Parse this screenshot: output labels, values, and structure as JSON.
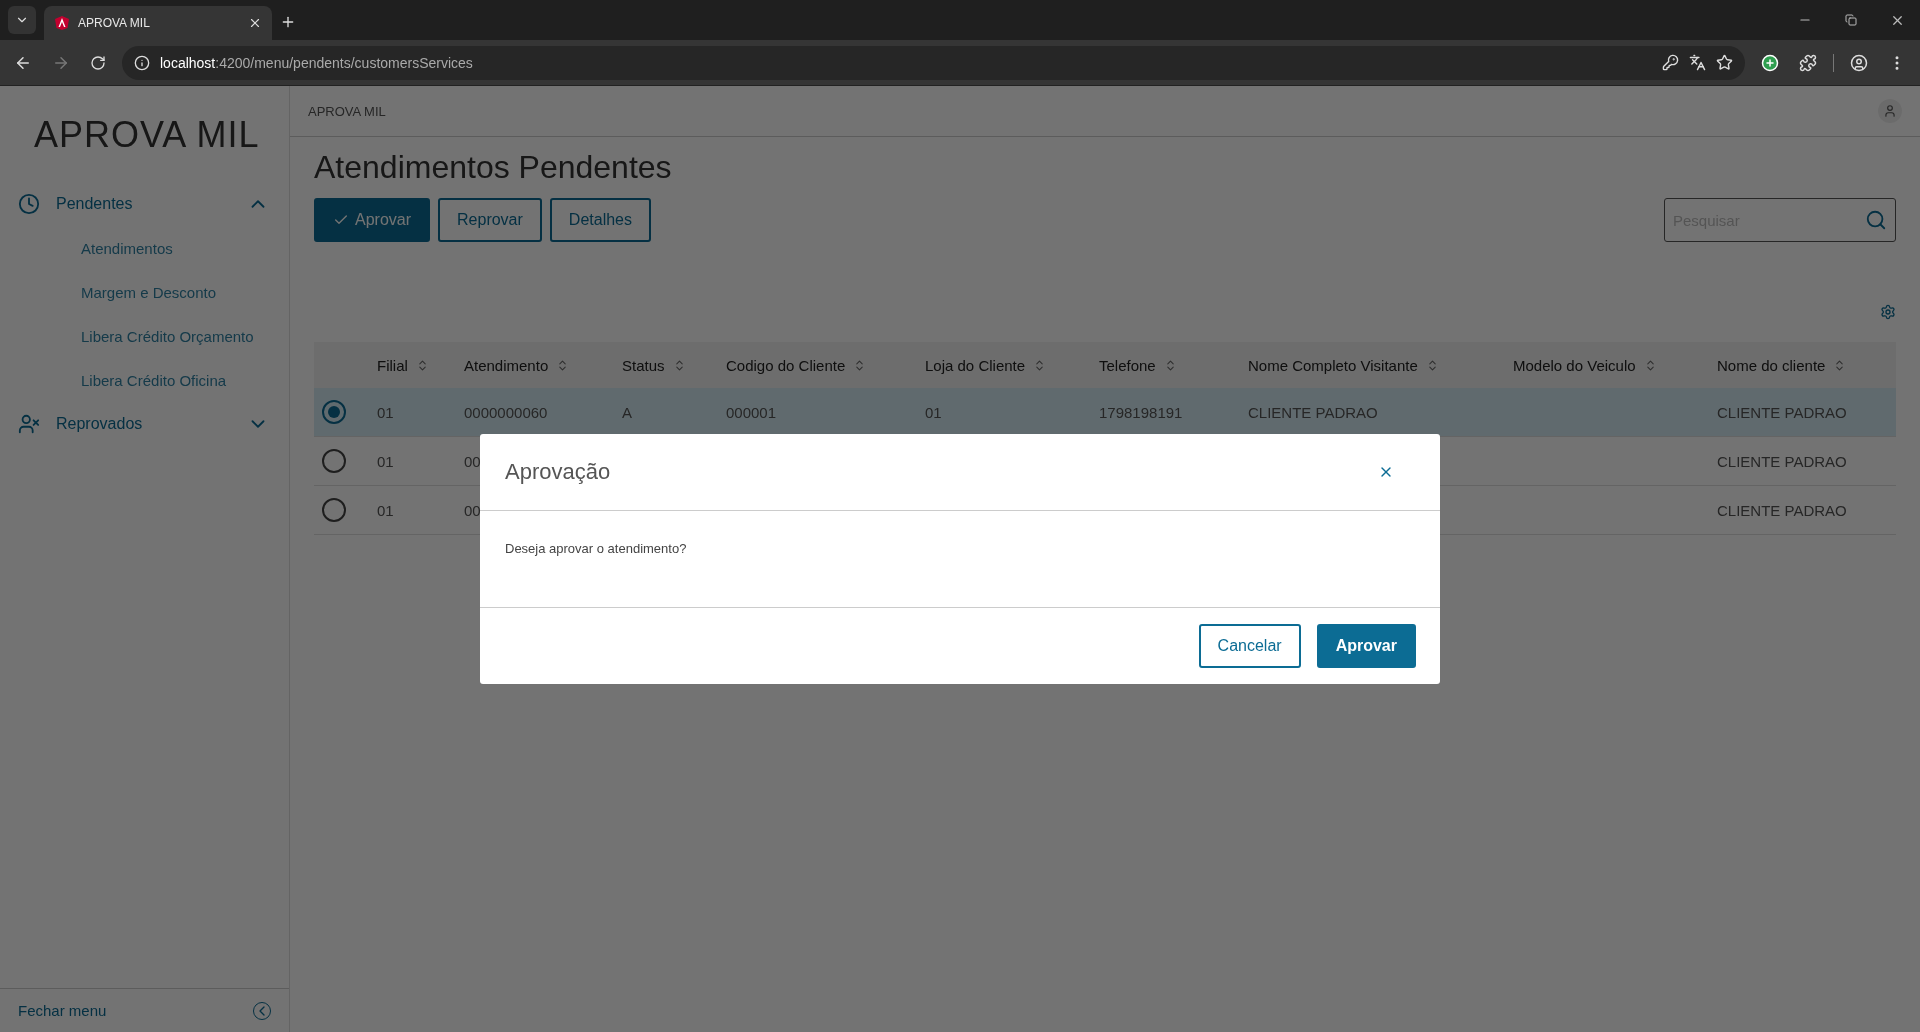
{
  "browser": {
    "tab_title": "APROVA MIL",
    "url_host": "localhost",
    "url_rest": ":4200/menu/pendents/customersServices"
  },
  "app": {
    "brand": "APROVA MIL",
    "header_brand": "APROVA MIL"
  },
  "sidebar": {
    "groups": [
      {
        "label": "Pendentes",
        "expanded": true,
        "children": [
          {
            "label": "Atendimentos"
          },
          {
            "label": "Margem e Desconto"
          },
          {
            "label": "Libera Crédito Orçamento"
          },
          {
            "label": "Libera Crédito Oficina"
          }
        ]
      },
      {
        "label": "Reprovados",
        "expanded": false
      }
    ],
    "footer": "Fechar menu"
  },
  "page": {
    "title": "Atendimentos Pendentes",
    "actions": [
      {
        "label": "Aprovar",
        "kind": "primary"
      },
      {
        "label": "Reprovar",
        "kind": "secondary"
      },
      {
        "label": "Detalhes",
        "kind": "secondary"
      }
    ],
    "search": {
      "placeholder": "Pesquisar"
    }
  },
  "table": {
    "columns": [
      "Filial",
      "Atendimento",
      "Status",
      "Codigo do Cliente",
      "Loja do Cliente",
      "Telefone",
      "Nome Completo Visitante",
      "Modelo do Veiculo",
      "Nome do cliente"
    ],
    "rows": [
      {
        "selected": true,
        "cells": [
          "01",
          "0000000060",
          "A",
          "000001",
          "01",
          "1798198191",
          "CLIENTE PADRAO",
          null,
          "CLIENTE PADRAO"
        ]
      },
      {
        "selected": false,
        "cells": [
          "01",
          "00",
          null,
          null,
          null,
          null,
          null,
          null,
          "CLIENTE PADRAO"
        ]
      },
      {
        "selected": false,
        "cells": [
          "01",
          "00",
          null,
          null,
          null,
          null,
          null,
          null,
          "CLIENTE PADRAO"
        ]
      }
    ]
  },
  "modal": {
    "title": "Aprovação",
    "message": "Deseja aprovar o atendimento?",
    "buttons": [
      {
        "label": "Cancelar",
        "kind": "secondary"
      },
      {
        "label": "Aprovar",
        "kind": "primary"
      }
    ]
  }
}
